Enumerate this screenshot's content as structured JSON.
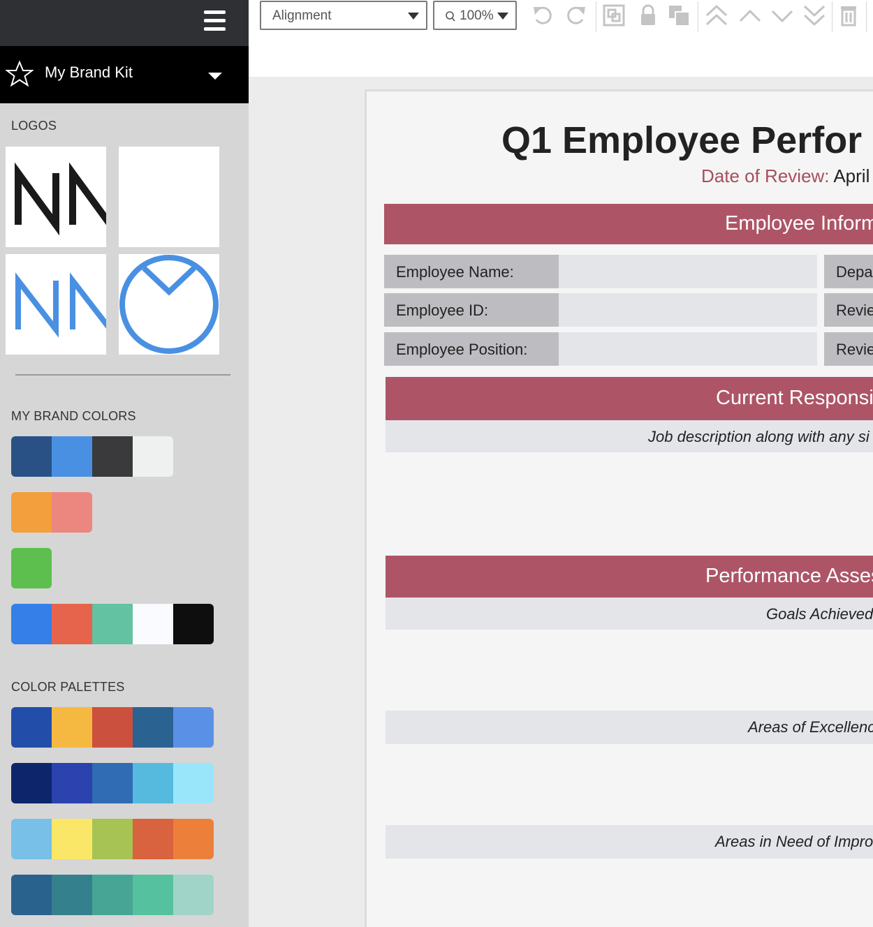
{
  "sidebar": {
    "brand_kit_label": "My Brand Kit",
    "sections": {
      "logos": "LOGOS",
      "brand_colors": "MY BRAND COLORS",
      "palettes": "COLOR PALETTES"
    },
    "logos": [
      {
        "text": "NN",
        "color": "#1a1a1a"
      },
      {
        "text": "",
        "color": "#ffffff"
      },
      {
        "text": "NN",
        "color": "#4a90e2"
      },
      {
        "text": "",
        "color": "#4a90e2"
      }
    ],
    "brand_colors": [
      [
        "#2a5185",
        "#4a90e2",
        "#3a3a3c",
        "#eff1f0"
      ],
      [
        "#f39f3e",
        "#ec8780"
      ],
      [
        "#5cbf4e"
      ],
      [
        "#3580e8",
        "#e5644b",
        "#62c2a2",
        "#f9fbfe",
        "#0e0e0e"
      ]
    ],
    "palettes": [
      [
        "#224ea9",
        "#f5b942",
        "#cc503e",
        "#2a6392",
        "#5a91e6"
      ],
      [
        "#0d266b",
        "#2c42af",
        "#2f6cb3",
        "#55badd",
        "#99e6fb"
      ],
      [
        "#78c0e8",
        "#fae768",
        "#a6c353",
        "#d9623f",
        "#ec803b"
      ],
      [
        "#2a628e",
        "#35808d",
        "#47a596",
        "#56c19e",
        "#a0d4c8"
      ]
    ]
  },
  "toolbar": {
    "alignment_label": "Alignment",
    "zoom_label": "100%",
    "icons": [
      "undo-icon",
      "redo-icon",
      "group-icon",
      "lock-icon",
      "duplicate-icon",
      "bring-to-front-icon",
      "bring-forward-icon",
      "send-backward-icon",
      "send-to-back-icon",
      "delete-icon"
    ]
  },
  "document": {
    "title": "Q1 Employee Perfor",
    "review_key": "Date of Review:",
    "review_value": "April",
    "sections": {
      "employee_info": "Employee Inform",
      "responsibilities": "Current Responsi",
      "assessment": "Performance Asses"
    },
    "fields": [
      {
        "label": "Employee Name:",
        "right": "Depa"
      },
      {
        "label": "Employee ID:",
        "right": "Revie"
      },
      {
        "label": "Employee Position:",
        "right": "Revie"
      }
    ],
    "notes": {
      "job_description": "Job description along with any si",
      "goals": "Goals Achieved",
      "excellence": "Areas of Excellenc",
      "improvement": "Areas in Need of Impro"
    }
  }
}
